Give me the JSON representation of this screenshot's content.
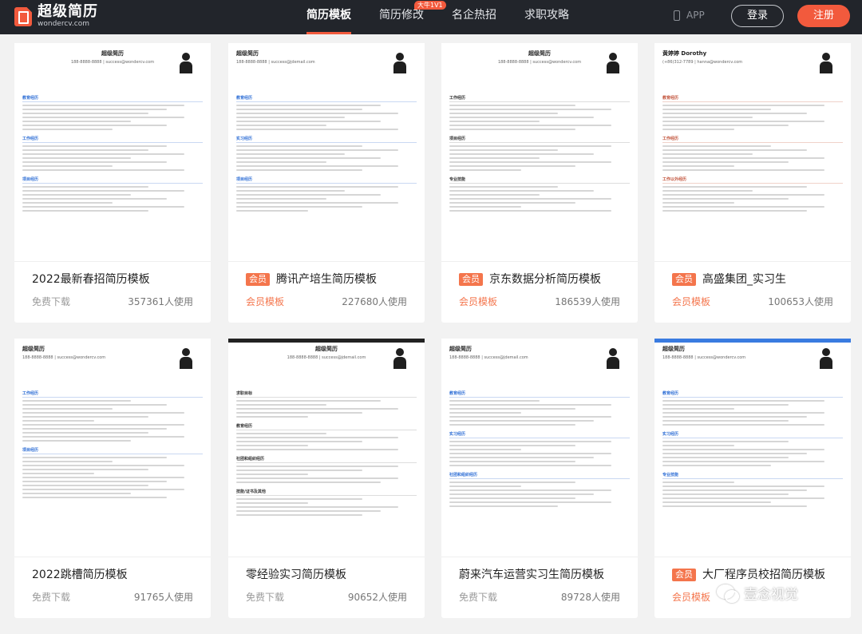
{
  "brand": {
    "name": "超级简历",
    "domain": "wondercv.com"
  },
  "nav": {
    "items": [
      {
        "label": "简历模板",
        "active": true
      },
      {
        "label": "简历修改",
        "badge": "大牛1V1"
      },
      {
        "label": "名企热招"
      },
      {
        "label": "求职攻略"
      }
    ],
    "app_label": "APP",
    "login_label": "登录",
    "register_label": "注册"
  },
  "cards": [
    {
      "title": "2022最新春招简历模板",
      "member": false,
      "type": "免费下载",
      "uses": "357361人使用"
    },
    {
      "title": "腾讯产培生简历模板",
      "member": true,
      "tag": "会员",
      "type": "会员模板",
      "uses": "227680人使用"
    },
    {
      "title": "京东数据分析简历模板",
      "member": true,
      "tag": "会员",
      "type": "会员模板",
      "uses": "186539人使用"
    },
    {
      "title": "高盛集团_实习生",
      "member": true,
      "tag": "会员",
      "type": "会员模板",
      "uses": "100653人使用"
    },
    {
      "title": "2022跳槽简历模板",
      "member": false,
      "type": "免费下载",
      "uses": "91765人使用"
    },
    {
      "title": "零经验实习简历模板",
      "member": false,
      "type": "免费下载",
      "uses": "90652人使用"
    },
    {
      "title": "蔚来汽车运营实习生简历模板",
      "member": false,
      "type": "免费下载",
      "uses": "89728人使用"
    },
    {
      "title": "大厂程序员校招简历模板",
      "member": true,
      "tag": "会员",
      "type": "会员模板",
      "uses": ""
    }
  ],
  "thumbs": [
    {
      "name": "超级简历",
      "contact": "188-8888-8888 | success@wondercv.com",
      "sections": [
        "教育经历",
        "工作经历",
        "项目经历"
      ],
      "style": "blue"
    },
    {
      "name": "超级简历",
      "contact": "188-8888-8888 | success@jdemail.com",
      "sections": [
        "教育经历",
        "实习经历",
        "项目经历"
      ],
      "style": "blue"
    },
    {
      "name": "超级简历",
      "contact": "188-8888-8888 | success@wondercv.com",
      "sections": [
        "工作经历",
        "项目经历",
        "专业技能"
      ],
      "style": "gray"
    },
    {
      "name": "黄婷婷 Dorothy",
      "contact": "(+86)312-7789 | hanna@wondercv.com",
      "sections": [
        "教育经历",
        "工作经历",
        "工作以外经历"
      ],
      "style": "red"
    },
    {
      "name": "超级简历",
      "contact": "188-8888-8888 | success@wondercv.com",
      "sections": [
        "工作经历",
        "项目经历"
      ],
      "style": "blue"
    },
    {
      "name": "超级简历",
      "contact": "188-8888-8888 | success@jdemail.com",
      "sections": [
        "求职目标",
        "教育经历",
        "社团和组织经历",
        "技能/证书及其他"
      ],
      "style": "gray"
    },
    {
      "name": "超级简历",
      "contact": "188-8888-8888 | success@jdemail.com",
      "sections": [
        "教育经历",
        "实习经历",
        "社团和组织经历"
      ],
      "style": "blue"
    },
    {
      "name": "超级简历",
      "contact": "188-8888-8888 | success@wondercv.com",
      "sections": [
        "教育经历",
        "实习经历",
        "专业技能"
      ],
      "style": "blue"
    }
  ],
  "watermark": {
    "text": "壹念视觉"
  },
  "colors": {
    "accent": "#f25a3d",
    "topbar": "#22252b",
    "member_tag": "#f4754c"
  }
}
